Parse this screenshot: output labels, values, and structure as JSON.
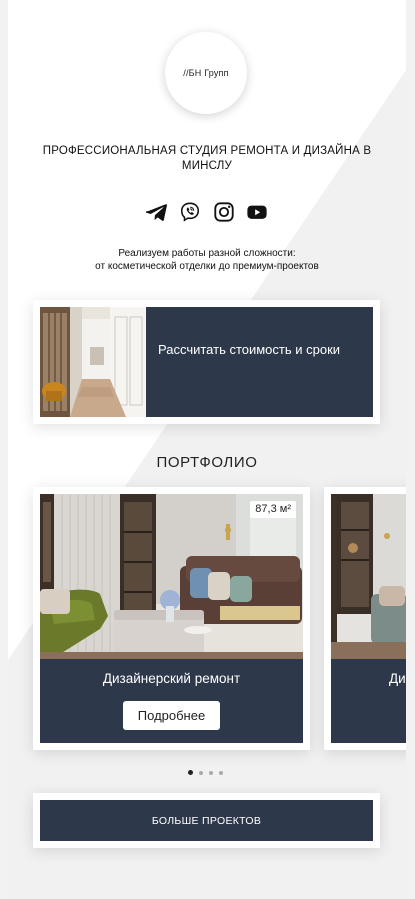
{
  "brand": {
    "logo_text": "//БН Групп",
    "headline": "ПРОФЕССИОНАЛЬНАЯ СТУДИЯ РЕМОНТА И ДИЗАЙНА В МИНСЛУ"
  },
  "socials": [
    {
      "icon": "telegram-icon"
    },
    {
      "icon": "viber-icon"
    },
    {
      "icon": "instagram-icon"
    },
    {
      "icon": "youtube-icon"
    }
  ],
  "tagline": {
    "line1": "Реализуем работы разной сложности:",
    "line2": "от косметической отделки до премиум-проектов"
  },
  "calc": {
    "label": "Рассчитать стоимость и сроки"
  },
  "portfolio": {
    "title": "ПОРТФОЛИО",
    "cards": [
      {
        "area": "87,3 м²",
        "title": "Дизайнерский ремонт",
        "button": "Подробнее"
      },
      {
        "title": "Ди"
      }
    ],
    "dots": {
      "count": 4,
      "active": 1
    }
  },
  "more_button": "БОЛЬШЕ ПРОЕКТОВ",
  "colors": {
    "panel": "#2d394a",
    "background": "#ffffff"
  }
}
